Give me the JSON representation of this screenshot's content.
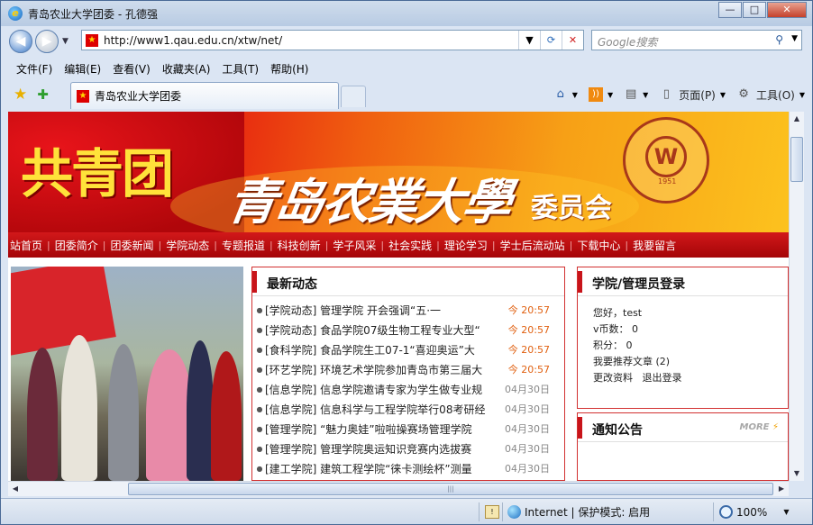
{
  "window": {
    "title": "青岛农业大学团委 - 孔德强",
    "minimize": "—",
    "maximize": "□",
    "close": "✕"
  },
  "address": {
    "url": "http://www1.qau.edu.cn/xtw/net/",
    "search_placeholder": "Google搜索"
  },
  "menu": [
    "文件(F)",
    "编辑(E)",
    "查看(V)",
    "收藏夹(A)",
    "工具(T)",
    "帮助(H)"
  ],
  "tab": {
    "title": "青岛农业大学团委"
  },
  "toolbar": {
    "page_label": "页面(P)",
    "tools_label": "工具(O)"
  },
  "banner": {
    "left_text": "共青团",
    "university": "青岛农業大學",
    "suffix": "委员会",
    "seal_center": "W",
    "seal_year": "1951"
  },
  "nav": [
    "站首页",
    "团委简介",
    "团委新闻",
    "学院动态",
    "专题报道",
    "科技创新",
    "学子风采",
    "社会实践",
    "理论学习",
    "学士后流动站",
    "下载中心",
    "我要留言"
  ],
  "news": {
    "heading": "最新动态",
    "items": [
      {
        "text": "[学院动态] 管理学院 开会强调“五·一",
        "date": "今 20:57",
        "today": true
      },
      {
        "text": "[学院动态] 食品学院07级生物工程专业大型“",
        "date": "今 20:57",
        "today": true
      },
      {
        "text": "[食科学院] 食品学院生工07-1“喜迎奥运”大",
        "date": "今 20:57",
        "today": true
      },
      {
        "text": "[环艺学院] 环境艺术学院参加青岛市第三届大",
        "date": "今 20:57",
        "today": true
      },
      {
        "text": "[信息学院] 信息学院邀请专家为学生做专业规",
        "date": "04月30日",
        "today": false
      },
      {
        "text": "[信息学院] 信息科学与工程学院举行08考研经",
        "date": "04月30日",
        "today": false
      },
      {
        "text": "[管理学院] “魅力奥娃”啦啦操赛场管理学院",
        "date": "04月30日",
        "today": false
      },
      {
        "text": "[管理学院] 管理学院奥运知识竞赛内选拔赛",
        "date": "04月30日",
        "today": false
      },
      {
        "text": "[建工学院] 建筑工程学院“徕卡测绘杯”测量",
        "date": "04月30日",
        "today": false
      }
    ]
  },
  "login": {
    "heading": "学院/管理员登录",
    "greeting": "您好，test",
    "coins": "v币数： 0",
    "points": "积分： 0",
    "recommend": "我要推荐文章 (2)",
    "edit_profile": "更改资料",
    "logout": "退出登录"
  },
  "notice": {
    "heading": "通知公告",
    "more": "MORE"
  },
  "status": {
    "zone": "Internet | 保护模式: 启用",
    "zoom": "100%"
  },
  "colors": {
    "accent_red": "#c8141a",
    "banner_orange": "#f7a016",
    "today_orange": "#e06010"
  },
  "icons": [
    "ie-icon",
    "back-icon",
    "forward-icon",
    "refresh-icon",
    "stop-icon",
    "search-icon",
    "favorites-star-icon",
    "add-favorite-icon",
    "home-icon",
    "rss-icon",
    "print-icon",
    "page-icon",
    "tools-gear-icon",
    "globe-icon",
    "zoom-icon"
  ]
}
